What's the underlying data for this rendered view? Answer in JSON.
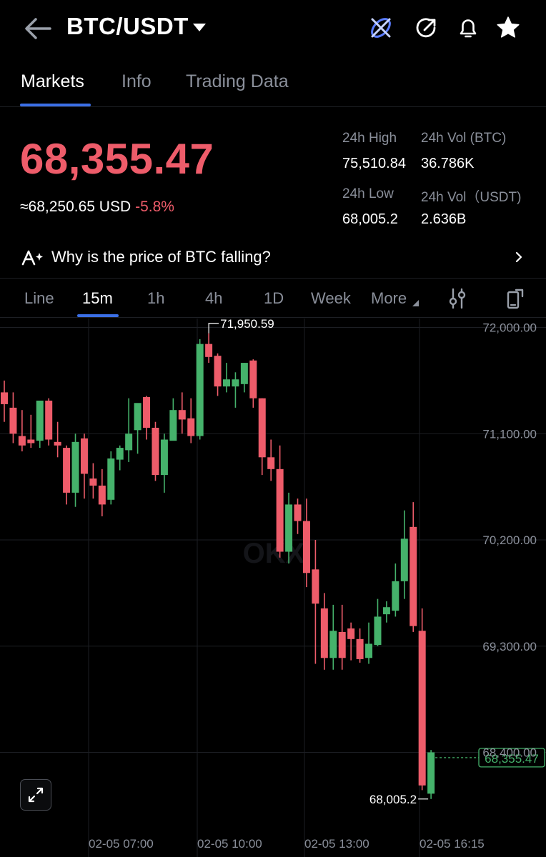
{
  "header": {
    "title": "BTC/USDT",
    "icons": [
      "back-arrow-icon",
      "dropdown-caret-icon",
      "okx-x-logo-icon",
      "share-icon",
      "bell-icon",
      "star-icon"
    ]
  },
  "tabs": [
    {
      "label": "Markets",
      "active": true
    },
    {
      "label": "Info",
      "active": false
    },
    {
      "label": "Trading Data",
      "active": false
    }
  ],
  "price": {
    "last": "68,355.47",
    "usd_equiv": "≈68,250.65 USD",
    "change": "-5.8%",
    "color_down": "#ee5c6a",
    "color_up": "#45b26b"
  },
  "stats": {
    "high_label": "24h High",
    "high_value": "75,510.84",
    "vol_btc_label": "24h Vol (BTC)",
    "vol_btc_value": "36.786K",
    "low_label": "24h Low",
    "low_value": "68,005.2",
    "vol_usdt_label": "24h Vol（USDT)",
    "vol_usdt_value": "2.636B"
  },
  "banner": {
    "text": "Why is the price of BTC falling?"
  },
  "intervals": [
    {
      "label": "Line",
      "active": false
    },
    {
      "label": "15m",
      "active": true
    },
    {
      "label": "1h",
      "active": false
    },
    {
      "label": "4h",
      "active": false
    },
    {
      "label": "1D",
      "active": false
    },
    {
      "label": "Week",
      "active": false
    },
    {
      "label": "More",
      "active": false
    }
  ],
  "chart_data": {
    "type": "candlestick",
    "y_ticks": [
      "72,000.00",
      "71,100.00",
      "70,200.00",
      "69,300.00",
      "68,400.00"
    ],
    "y_tick_values": [
      72000,
      71100,
      70200,
      69300,
      68400
    ],
    "x_ticks": [
      "02-05 07:00",
      "02-05 10:00",
      "02-05 13:00",
      "02-05 16:15"
    ],
    "high_marker": "71,950.59",
    "low_marker": "68,005.2",
    "current_price_tag": "68,355.47",
    "current_price": 68355.47,
    "watermark": "OKX",
    "candles": [
      {
        "o": 71450,
        "h": 71550,
        "c": 71350,
        "l": 71200
      },
      {
        "o": 71320,
        "h": 71450,
        "c": 71100,
        "l": 71020
      },
      {
        "o": 71080,
        "h": 71300,
        "c": 71000,
        "l": 70950
      },
      {
        "o": 71050,
        "h": 71260,
        "c": 71020,
        "l": 70980
      },
      {
        "o": 71040,
        "h": 71350,
        "c": 71380,
        "l": 70980
      },
      {
        "o": 71380,
        "h": 71400,
        "c": 71050,
        "l": 71000
      },
      {
        "o": 71030,
        "h": 71200,
        "c": 71000,
        "l": 70900
      },
      {
        "o": 70980,
        "h": 71000,
        "c": 70600,
        "l": 70500
      },
      {
        "o": 70600,
        "h": 71100,
        "c": 71030,
        "l": 70480
      },
      {
        "o": 71060,
        "h": 71100,
        "c": 70760,
        "l": 70550
      },
      {
        "o": 70720,
        "h": 70850,
        "c": 70660,
        "l": 70550
      },
      {
        "o": 70660,
        "h": 70800,
        "c": 70500,
        "l": 70400
      },
      {
        "o": 70540,
        "h": 70950,
        "c": 70890,
        "l": 70500
      },
      {
        "o": 70880,
        "h": 71000,
        "c": 70980,
        "l": 70790
      },
      {
        "o": 70960,
        "h": 71400,
        "c": 71100,
        "l": 70860
      },
      {
        "o": 71130,
        "h": 71350,
        "c": 71360,
        "l": 70930
      },
      {
        "o": 71410,
        "h": 71420,
        "c": 71150,
        "l": 71050
      },
      {
        "o": 71150,
        "h": 71200,
        "c": 70750,
        "l": 70700
      },
      {
        "o": 70750,
        "h": 71100,
        "c": 71050,
        "l": 70600
      },
      {
        "o": 71040,
        "h": 71400,
        "c": 71300,
        "l": 71050
      },
      {
        "o": 71300,
        "h": 71450,
        "c": 71220,
        "l": 71100
      },
      {
        "o": 71230,
        "h": 71400,
        "c": 71080,
        "l": 71020
      },
      {
        "o": 71080,
        "h": 71900,
        "c": 71860,
        "l": 71050
      },
      {
        "o": 71860,
        "h": 71950,
        "c": 71750,
        "l": 71700
      },
      {
        "o": 71760,
        "h": 71780,
        "c": 71500,
        "l": 71420
      },
      {
        "o": 71500,
        "h": 71700,
        "c": 71560,
        "l": 71450
      },
      {
        "o": 71500,
        "h": 71620,
        "c": 71560,
        "l": 71320
      },
      {
        "o": 71520,
        "h": 71700,
        "c": 71700,
        "l": 71450
      },
      {
        "o": 71720,
        "h": 71730,
        "c": 71400,
        "l": 71320
      },
      {
        "o": 71400,
        "h": 71400,
        "c": 70900,
        "l": 70750
      },
      {
        "o": 70900,
        "h": 71050,
        "c": 70800,
        "l": 70700
      },
      {
        "o": 70800,
        "h": 71000,
        "c": 70100,
        "l": 70050
      },
      {
        "o": 70100,
        "h": 70600,
        "c": 70500,
        "l": 70000
      },
      {
        "o": 70500,
        "h": 70550,
        "c": 70360,
        "l": 70250
      },
      {
        "o": 70360,
        "h": 70550,
        "c": 69920,
        "l": 69800
      },
      {
        "o": 69950,
        "h": 70200,
        "c": 69660,
        "l": 69150
      },
      {
        "o": 69620,
        "h": 69750,
        "c": 69200,
        "l": 69100
      },
      {
        "o": 69200,
        "h": 69650,
        "c": 69430,
        "l": 69100
      },
      {
        "o": 69420,
        "h": 69650,
        "c": 69200,
        "l": 69100
      },
      {
        "o": 69450,
        "h": 69500,
        "c": 69360,
        "l": 69180
      },
      {
        "o": 69360,
        "h": 69450,
        "c": 69190,
        "l": 69160
      },
      {
        "o": 69200,
        "h": 69500,
        "c": 69320,
        "l": 69150
      },
      {
        "o": 69310,
        "h": 69700,
        "c": 69550,
        "l": 69300
      },
      {
        "o": 69570,
        "h": 69680,
        "c": 69630,
        "l": 69500
      },
      {
        "o": 69600,
        "h": 70000,
        "c": 69850,
        "l": 69550
      },
      {
        "o": 69850,
        "h": 70450,
        "c": 70210,
        "l": 69700
      },
      {
        "o": 70310,
        "h": 70520,
        "c": 69470,
        "l": 69420
      },
      {
        "o": 69430,
        "h": 69620,
        "c": 68120,
        "l": 68080
      },
      {
        "o": 68050,
        "h": 68420,
        "c": 68400,
        "l": 68005
      }
    ]
  }
}
